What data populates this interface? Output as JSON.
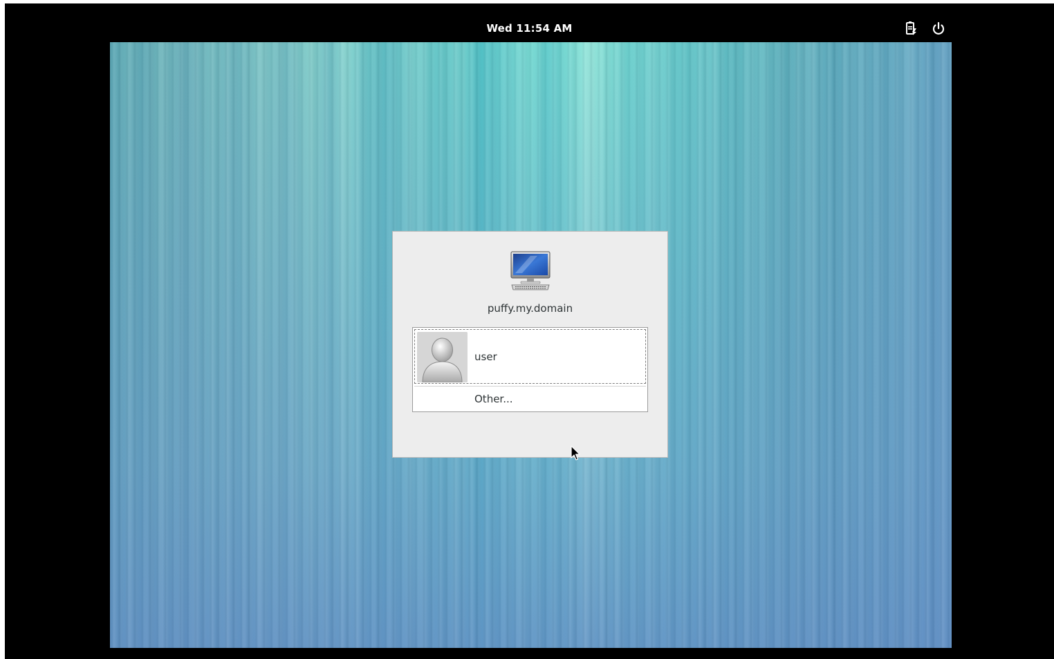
{
  "topbar": {
    "clock": "Wed 11:54 AM",
    "icons": [
      "battery-icon",
      "power-icon"
    ]
  },
  "login": {
    "host_icon": "computer-icon",
    "hostname": "puffy.my.domain",
    "users": [
      {
        "name": "user",
        "avatar": "user-avatar-icon"
      }
    ],
    "other_label": "Other..."
  },
  "colors": {
    "panel_bg": "#000000",
    "dialog_bg": "#ededed",
    "text": "#2e3436",
    "wallpaper_accent": "#7ddcd3"
  }
}
